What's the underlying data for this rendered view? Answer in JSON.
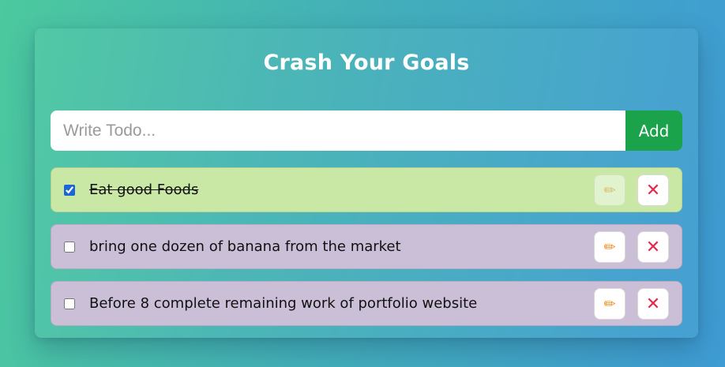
{
  "app": {
    "title": "Crash Your Goals"
  },
  "form": {
    "placeholder": "Write Todo...",
    "value": "",
    "add_label": "Add"
  },
  "todos": [
    {
      "text": "Eat good Foods",
      "completed": true
    },
    {
      "text": "bring one dozen of banana from the market",
      "completed": false
    },
    {
      "text": " Before 8 complete remaining work of portfolio website",
      "completed": false
    }
  ],
  "icons": {
    "edit": "pencil-icon",
    "delete": "close-icon"
  },
  "colors": {
    "completed_bg": "#c9e8a6",
    "pending_bg": "#cbbfd8",
    "add_button": "#1aa34a",
    "edit_icon": "#f28a1c",
    "delete_icon": "#e8254a"
  }
}
